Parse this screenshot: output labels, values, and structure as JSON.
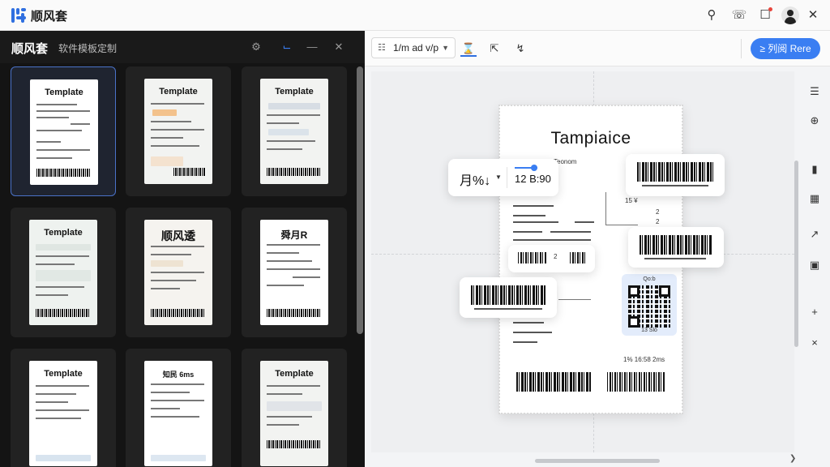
{
  "app": {
    "title": "顺风套"
  },
  "left_panel": {
    "title": "顺风套",
    "subtitle": "软件模板定制",
    "templates": [
      {
        "title": "Template",
        "selected": true
      },
      {
        "title": "Template",
        "selected": false
      },
      {
        "title": "Template",
        "selected": false
      },
      {
        "title": "Template",
        "selected": false
      },
      {
        "title": "顺风逶",
        "selected": false
      },
      {
        "title": "舜月R",
        "selected": false
      },
      {
        "title": "Template",
        "selected": false
      },
      {
        "title": "知民 6ms",
        "selected": false
      },
      {
        "title": "Template",
        "selected": false
      }
    ]
  },
  "toolbar": {
    "size_select": "1/m ad v/p",
    "print_label": "≥ 列阅 Rere"
  },
  "label": {
    "title": "Tampiaice",
    "subtitle": "Teonom",
    "right_texts": [
      "15 ¥",
      "2",
      "2"
    ],
    "mid_text": "2",
    "qr_top": "Qo:b",
    "qr_bottom": "13 Slo",
    "bottom_right_top": "1%\n16:58 2ms"
  },
  "chips": {
    "font_value": "月%↓",
    "font_size": "12 B:90"
  },
  "colors": {
    "accent": "#3a7ef2",
    "dark_panel": "#141414"
  }
}
